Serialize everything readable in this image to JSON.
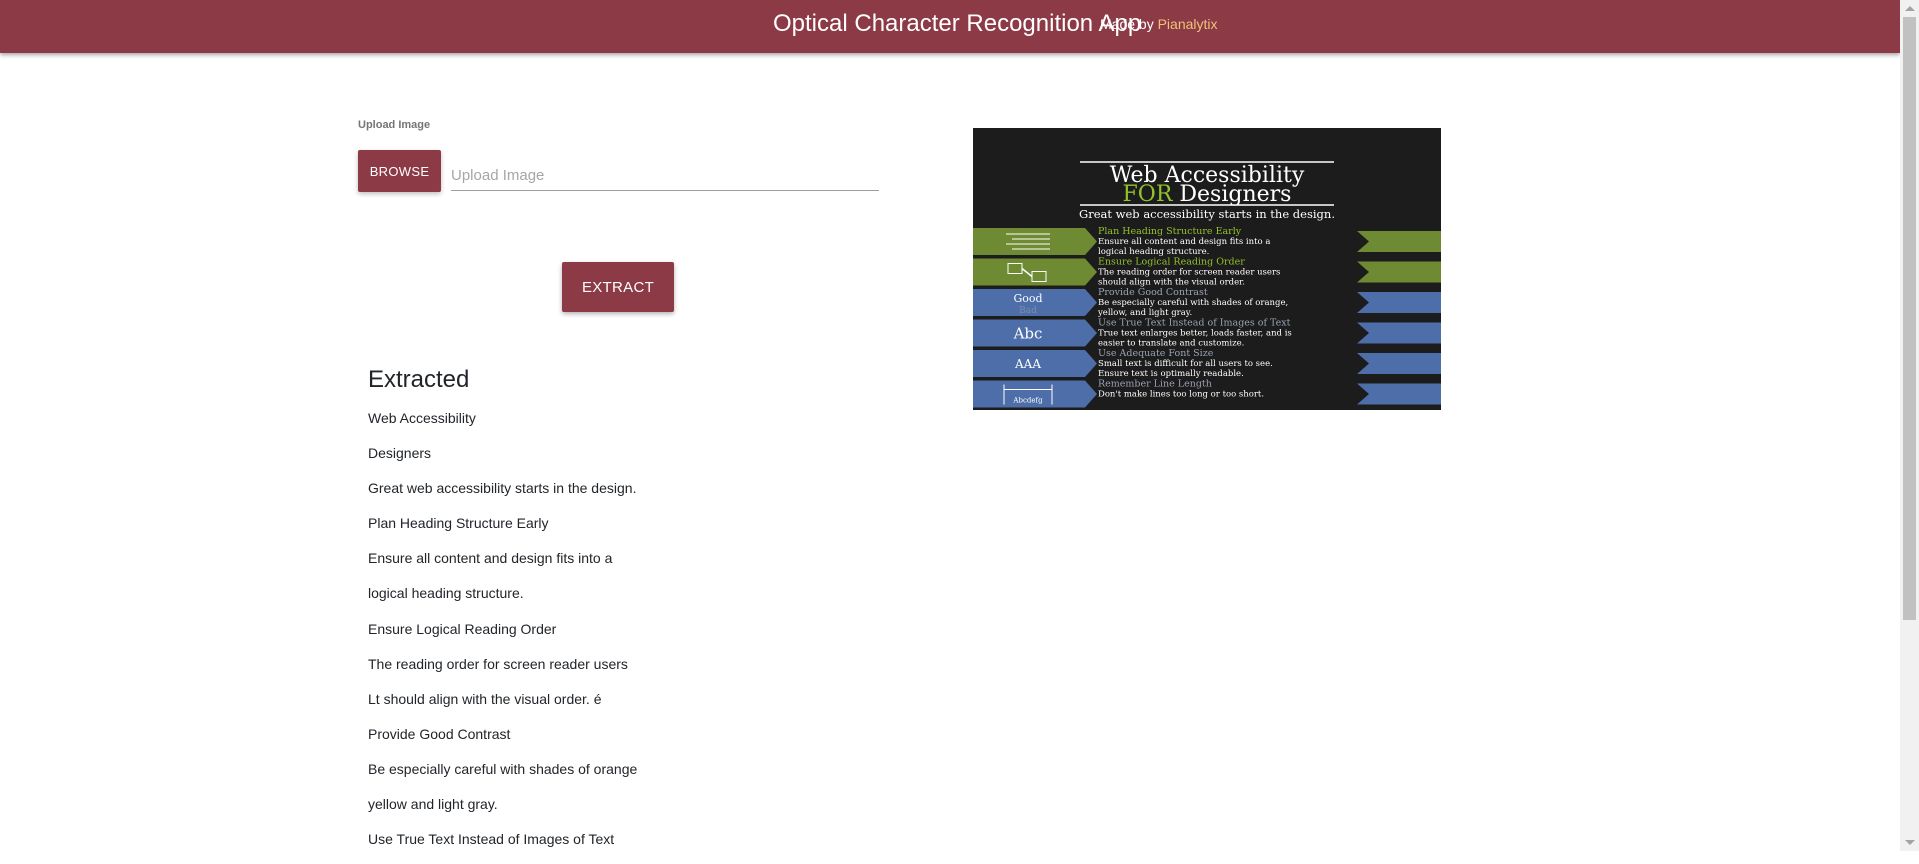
{
  "header": {
    "title": "Optical Character Recognition App",
    "made_by": "Made by",
    "brand": "Pianalytix"
  },
  "upload": {
    "label": "Upload Image",
    "browse_label": "BROWSE",
    "placeholder": "Upload Image"
  },
  "extract_label": "EXTRACT",
  "extracted": {
    "heading": "Extracted",
    "lines": [
      "Web Accessibility",
      "Designers",
      "Great web accessibility starts in the design.",
      "Plan Heading Structure Early",
      "Ensure all content and design fits into a",
      "logical heading structure.",
      "Ensure Logical Reading Order",
      "The reading order for screen reader users",
      "Lt should align with the visual order. é",
      "Provide Good Contrast",
      "Be especially careful with shades of orange",
      "yellow and light gray.",
      "Use True Text Instead of Images of Text"
    ]
  },
  "preview": {
    "title_line1": "Web Accessibility",
    "title_for": "FOR",
    "title_line2": "Designers",
    "subtitle": "Great web accessibility starts in the design.",
    "colors": {
      "background": "#1c1c1c",
      "green_band": "#6e8a32",
      "blue_band": "#4d6ea8",
      "title_accent": "#93c22b"
    },
    "rows": [
      {
        "icon": "heading-lines-icon",
        "band": "green",
        "heading": "Plan Heading Structure Early",
        "line1": "Ensure all content and design fits into a",
        "line2": "logical heading structure."
      },
      {
        "icon": "reading-order-icon",
        "band": "green",
        "heading": "Ensure Logical Reading Order",
        "line1": "The reading order for screen reader users",
        "line2": "should align with the visual order."
      },
      {
        "icon": "contrast-icon",
        "icon_text": "Good",
        "icon_text2": "Bad",
        "band": "blue",
        "heading": "Provide Good Contrast",
        "line1": "Be especially careful with shades of orange,",
        "line2": "yellow, and light gray."
      },
      {
        "icon": "true-text-icon",
        "icon_text": "Abc",
        "band": "blue",
        "heading": "Use True Text Instead of Images of Text",
        "line1": "True text enlarges better, loads faster, and is",
        "line2": "easier to translate and customize."
      },
      {
        "icon": "font-size-icon",
        "icon_text": "AAA",
        "band": "blue",
        "heading": "Use Adequate Font Size",
        "line1": "Small text is difficult for all users to see.",
        "line2": "Ensure text is optimally readable."
      },
      {
        "icon": "line-length-icon",
        "icon_text": "Abcdefg",
        "band": "blue",
        "heading": "Remember Line Length",
        "line1": "Don't make lines too long or too short.",
        "line2": ""
      }
    ]
  }
}
